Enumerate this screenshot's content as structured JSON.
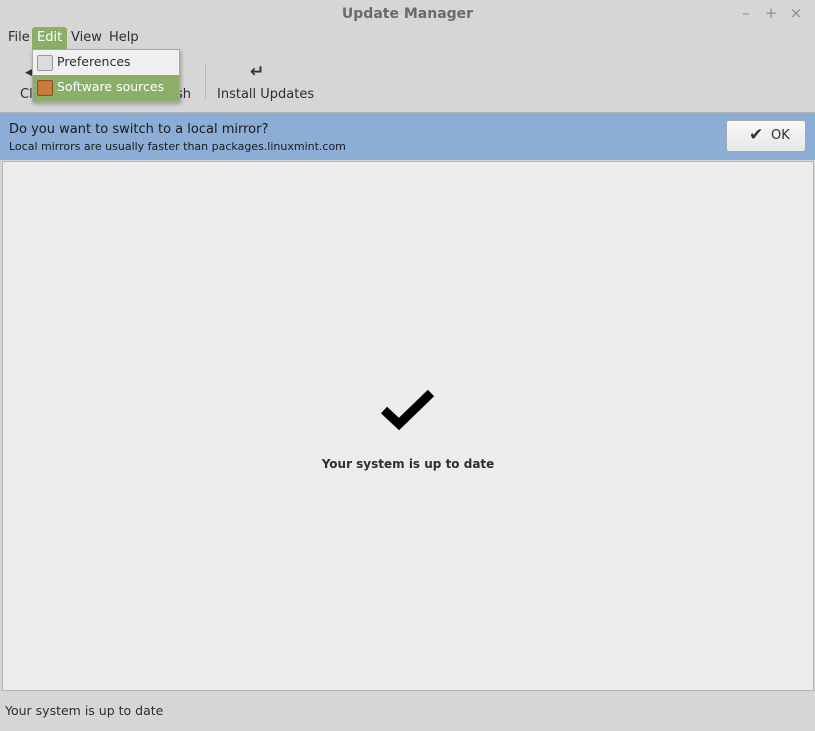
{
  "window": {
    "title": "Update Manager",
    "controls": {
      "minimize": "–",
      "maximize": "+",
      "close": "×"
    }
  },
  "menubar": {
    "file": "File",
    "edit": "Edit",
    "view": "View",
    "help": "Help"
  },
  "edit_menu": {
    "items": [
      {
        "label": "Preferences",
        "icon": "preferences-icon"
      },
      {
        "label": "Software sources",
        "icon": "software-sources-icon"
      }
    ]
  },
  "toolbar": {
    "clear_label_visible": "Cl",
    "refresh_label_visible": "sh",
    "install_label": "Install Updates",
    "install_icon": "↵"
  },
  "infobar": {
    "primary": "Do you want to switch to a local mirror?",
    "secondary": "Local mirrors are usually faster than packages.linuxmint.com",
    "ok_label": "OK"
  },
  "main": {
    "status_message": "Your system is up to date"
  },
  "statusbar": {
    "text": "Your system is up to date"
  },
  "colors": {
    "accent": "#8bae69",
    "infobar": "#8badd6"
  }
}
